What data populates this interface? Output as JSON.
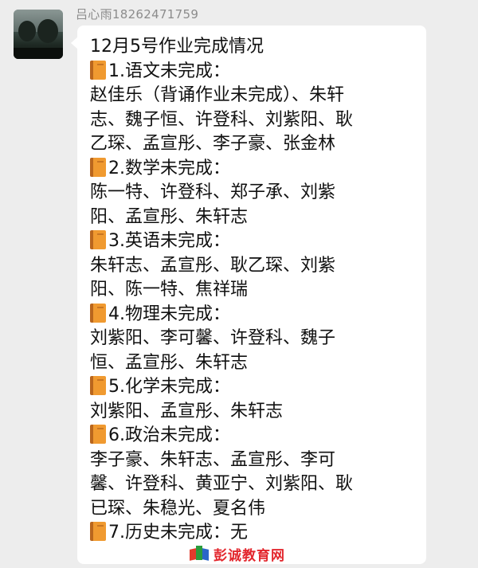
{
  "message": {
    "sender": "吕心雨18262471759",
    "title": "12月5号作业完成情况",
    "lines": [
      {
        "icon": "orange-book-icon",
        "text": "1.语文未完成："
      },
      {
        "text": "赵佳乐（背诵作业未完成）、朱轩"
      },
      {
        "text": "志、魏子恒、许登科、刘紫阳、耿"
      },
      {
        "text": "乙琛、孟宣彤、李子豪、张金林"
      },
      {
        "icon": "orange-book-icon",
        "text": "2.数学未完成："
      },
      {
        "text": "陈一特、许登科、郑子承、刘紫"
      },
      {
        "text": "阳、孟宣彤、朱轩志"
      },
      {
        "icon": "orange-book-icon",
        "text": "3.英语未完成："
      },
      {
        "text": "朱轩志、孟宣彤、耿乙琛、刘紫"
      },
      {
        "text": "阳、陈一特、焦祥瑞"
      },
      {
        "icon": "orange-book-icon",
        "text": "4.物理未完成："
      },
      {
        "text": "刘紫阳、李可馨、许登科、魏子"
      },
      {
        "text": "恒、孟宣彤、朱轩志"
      },
      {
        "icon": "orange-book-icon",
        "text": "5.化学未完成："
      },
      {
        "text": "刘紫阳、孟宣彤、朱轩志"
      },
      {
        "icon": "orange-book-icon",
        "text": "6.政治未完成："
      },
      {
        "text": "李子豪、朱轩志、孟宣彤、李可"
      },
      {
        "text": "馨、许登科、黄亚宁、刘紫阳、耿"
      },
      {
        "text": "已琛、朱稳光、夏名伟"
      },
      {
        "icon": "orange-book-icon",
        "text": "7.历史未完成：无"
      }
    ]
  },
  "watermark": {
    "text": "彭诚教育网"
  },
  "colors": {
    "background": "#ededed",
    "bubble": "#ffffff",
    "sender_name": "#8c8c8c",
    "watermark": "#e3262d"
  }
}
